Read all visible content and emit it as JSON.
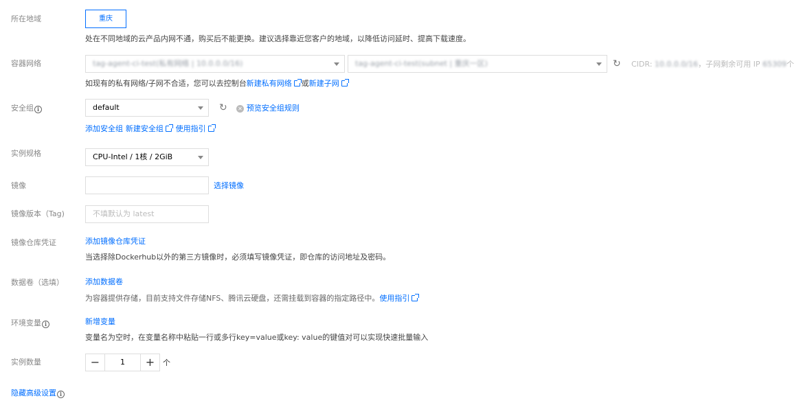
{
  "region": {
    "label": "所在地域",
    "button": "重庆",
    "hint": "处在不同地域的云产品内网不通，购买后不能更换。建议选择靠近您客户的地域，以降低访问延时、提高下载速度。"
  },
  "network": {
    "label": "容器网络",
    "vpc_value": "tag-agent-ci-test(私有网络 | 10.0.0.0/16)",
    "subnet_value": "tag-agent-ci-test(subnet | 重庆一区)",
    "cidr_label": "CIDR:",
    "cidr_value": "10.0.0.0/16",
    "available_prefix": "，子网剩余可用 IP",
    "available_value": "65309",
    "available_suffix": "个",
    "hint_prefix": "如现有的私有网络/子网不合适，您可以去控制台",
    "create_vpc": "新建私有网络",
    "hint_or": "或",
    "create_subnet": "新建子网"
  },
  "security_group": {
    "label": "安全组",
    "value": "default",
    "preview": "预览安全组规则",
    "add": "添加安全组",
    "create": "新建安全组",
    "guide": "使用指引"
  },
  "spec": {
    "label": "实例规格",
    "value": "CPU-Intel / 1核 / 2GiB"
  },
  "image": {
    "label": "镜像",
    "value": "",
    "select": "选择镜像"
  },
  "image_tag": {
    "label": "镜像版本（Tag)",
    "placeholder": "不填默认为 latest"
  },
  "registry": {
    "label": "镜像仓库凭证",
    "add": "添加镜像仓库凭证",
    "hint": "当选择除Dockerhub以外的第三方镜像时，必须填写镜像凭证，即仓库的访问地址及密码。"
  },
  "volume": {
    "label": "数据卷（选填）",
    "add": "添加数据卷",
    "hint": "为容器提供存储，目前支持文件存储NFS、腾讯云硬盘，还需挂载到容器的指定路径中。",
    "guide": "使用指引"
  },
  "env": {
    "label": "环境变量",
    "add": "新增变量",
    "hint": "变量名为空时，在变量名称中粘贴一行或多行key=value或key: value的键值对可以实现快速批量输入"
  },
  "count": {
    "label": "实例数量",
    "minus": "−",
    "value": "1",
    "plus": "+",
    "unit": "个"
  },
  "advanced": {
    "label": "隐藏高级设置"
  },
  "colors": {
    "link": "#006eff",
    "label": "#888888",
    "border": "#dddddd"
  }
}
